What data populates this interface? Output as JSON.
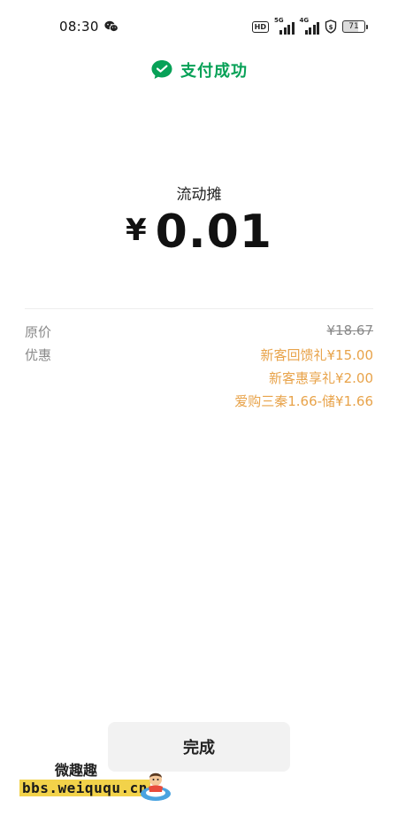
{
  "status_bar": {
    "time": "08:30",
    "hd_label": "HD",
    "signal_1_gen": "5G",
    "signal_2_gen": "4G",
    "battery_level": "71"
  },
  "header": {
    "success_text": "支付成功",
    "brand_color": "#07a157"
  },
  "payment": {
    "merchant": "流动摊",
    "currency_symbol": "¥",
    "amount": "0.01"
  },
  "details": {
    "original_price_label": "原价",
    "original_price": "¥18.67",
    "discount_label": "优惠",
    "discounts": [
      "新客回馈礼¥15.00",
      "新客惠享礼¥2.00",
      "爱购三秦1.66-储¥1.66"
    ],
    "discount_color": "#e8a34a"
  },
  "actions": {
    "done_label": "完成"
  },
  "watermark": {
    "title": "微趣趣",
    "url": "bbs.weiququ.cn"
  }
}
